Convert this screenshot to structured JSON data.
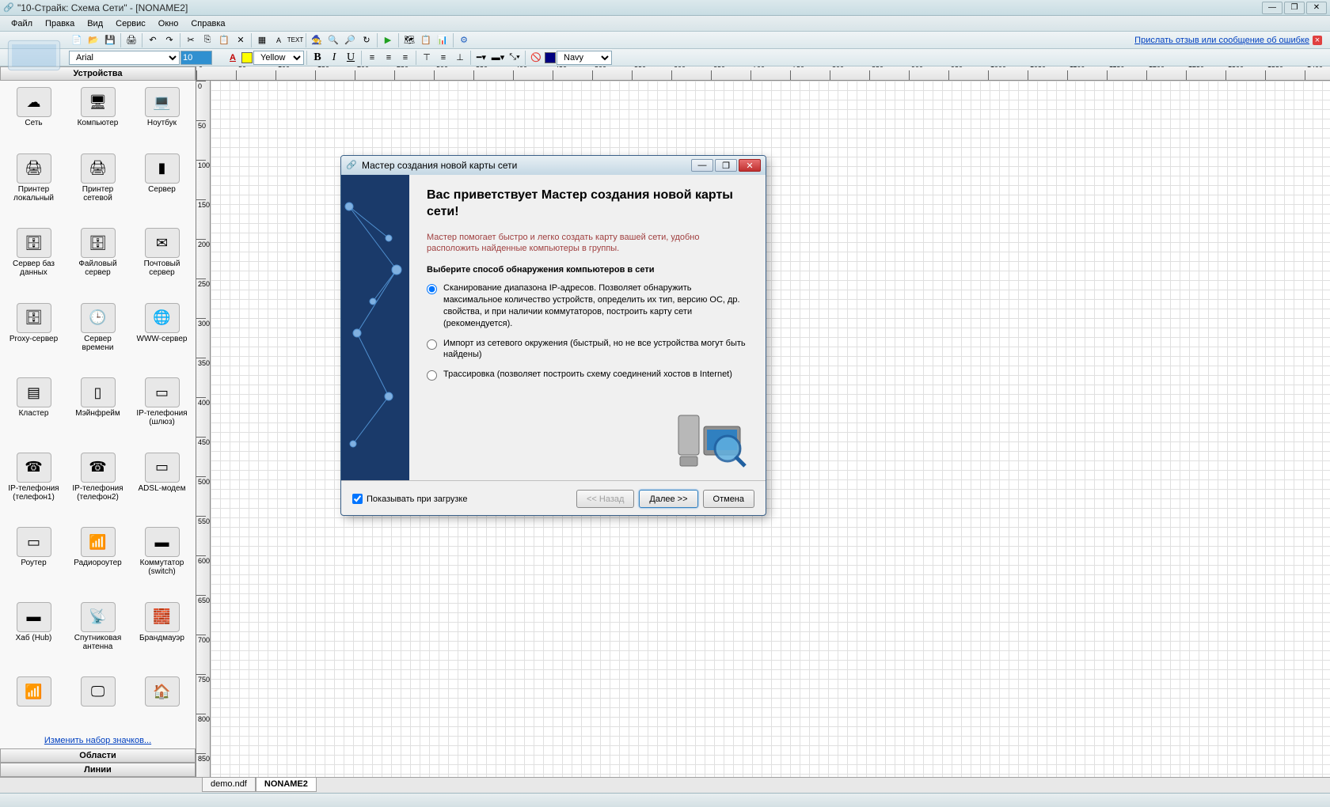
{
  "titlebar": {
    "title": "\"10-Страйк: Схема Сети\" - [NONAME2]"
  },
  "menu": [
    "Файл",
    "Правка",
    "Вид",
    "Сервис",
    "Окно",
    "Справка"
  ],
  "toolbar": {
    "feedback_link": "Прислать отзыв или сообщение об ошибке"
  },
  "formatbar": {
    "font_name": "Arial",
    "font_size": "10",
    "fill_color_name": "Yellow",
    "fill_color_hex": "#ffff00",
    "text_color_hex": "#c00000",
    "line_color_name": "Navy",
    "line_color_hex": "#000080"
  },
  "sidebar": {
    "header": "Устройства",
    "link": "Изменить набор значков...",
    "section_areas": "Области",
    "section_lines": "Линии",
    "devices": [
      {
        "label": "Сеть",
        "glyph": "☁"
      },
      {
        "label": "Компьютер",
        "glyph": "🖥"
      },
      {
        "label": "Ноутбук",
        "glyph": "💻"
      },
      {
        "label": "Принтер локальный",
        "glyph": "🖨"
      },
      {
        "label": "Принтер сетевой",
        "glyph": "🖨"
      },
      {
        "label": "Сервер",
        "glyph": "▮"
      },
      {
        "label": "Сервер баз данных",
        "glyph": "🗄"
      },
      {
        "label": "Файловый сервер",
        "glyph": "🗄"
      },
      {
        "label": "Почтовый сервер",
        "glyph": "✉"
      },
      {
        "label": "Proxy-сервер",
        "glyph": "🗄"
      },
      {
        "label": "Сервер времени",
        "glyph": "🕒"
      },
      {
        "label": "WWW-сервер",
        "glyph": "🌐"
      },
      {
        "label": "Кластер",
        "glyph": "▤"
      },
      {
        "label": "Мэйнфрейм",
        "glyph": "▯"
      },
      {
        "label": "IP-телефония (шлюз)",
        "glyph": "▭"
      },
      {
        "label": "IP-телефония (телефон1)",
        "glyph": "☎"
      },
      {
        "label": "IP-телефония (телефон2)",
        "glyph": "☎"
      },
      {
        "label": "ADSL-модем",
        "glyph": "▭"
      },
      {
        "label": "Роутер",
        "glyph": "▭"
      },
      {
        "label": "Радиороутер",
        "glyph": "📶"
      },
      {
        "label": "Коммутатор (switch)",
        "glyph": "▬"
      },
      {
        "label": "Хаб (Hub)",
        "glyph": "▬"
      },
      {
        "label": "Спутниковая антенна",
        "glyph": "📡"
      },
      {
        "label": "Брандмауэр",
        "glyph": "🧱"
      },
      {
        "label": "",
        "glyph": "📶"
      },
      {
        "label": "",
        "glyph": "🖵"
      },
      {
        "label": "",
        "glyph": "🏠"
      }
    ]
  },
  "tabs": [
    "demo.ndf",
    "NONAME2"
  ],
  "active_tab": 1,
  "modal": {
    "title": "Мастер создания новой карты сети",
    "heading": "Вас приветствует Мастер создания новой карты сети!",
    "desc": "Мастер помогает быстро и легко создать карту вашей сети, удобно расположить найденные компьютеры в группы.",
    "subhead": "Выберите способ обнаружения компьютеров в сети",
    "options": [
      "Сканирование диапазона IP-адресов. Позволяет обнаружить максимальное количество устройств, определить их тип, версию ОС, др. свойства, и при наличии коммутаторов, построить карту сети (рекомендуется).",
      "Импорт из сетевого окружения (быстрый, но не все устройства могут быть найдены)",
      "Трассировка (позволяет построить схему соединений хостов в Internet)"
    ],
    "show_on_start": "Показывать при загрузке",
    "btn_back": "<< Назад",
    "btn_next": "Далее >>",
    "btn_cancel": "Отмена"
  }
}
